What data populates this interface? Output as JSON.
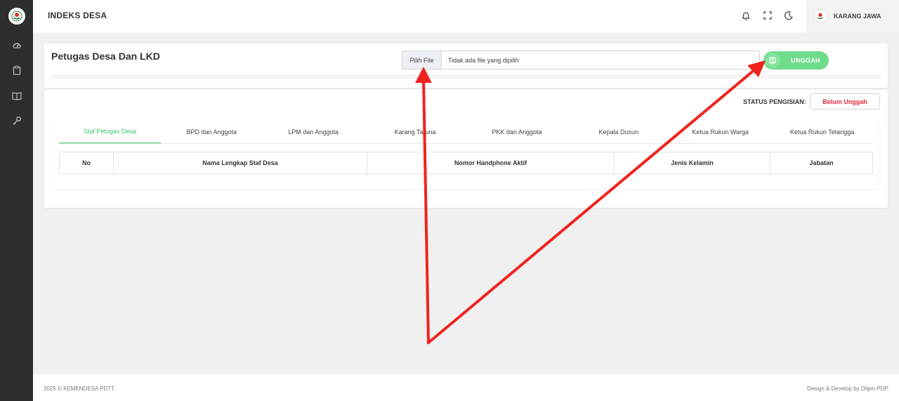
{
  "header": {
    "app_title": "INDEKS DESA",
    "user_name": "KARANG JAWA"
  },
  "sidebar": {
    "items": [
      {
        "icon": "dashboard-icon"
      },
      {
        "icon": "clipboard-icon"
      },
      {
        "icon": "book-icon"
      },
      {
        "icon": "key-icon"
      }
    ]
  },
  "main": {
    "page_title": "Petugas Desa Dan LKD",
    "file_input": {
      "button_label": "Pilih File",
      "value": "Tidak ada file yang dipilih"
    },
    "upload_button_label": "UNGGAH",
    "status_label": "STATUS PENGISIAN:",
    "status_value": "Belum Unggah",
    "tabs": [
      "Staf Petugas Desa",
      "BPD dan Anggota",
      "LPM dan Anggota",
      "Karang Taruna",
      "PKK dan Anggota",
      "Kepala Dusun",
      "Ketua Rukun Warga",
      "Ketua Rukun Tetangga"
    ],
    "active_tab": "Staf Petugas Desa",
    "table_headers": [
      "No",
      "Nama Lengkap Staf Desa",
      "Nomor Handphone Aktif",
      "Jenis Kelamin",
      "Jabatan"
    ]
  },
  "footer": {
    "left": "2025 © KEMENDESA PDTT.",
    "right": "Design & Develop by Ditjen PDP"
  },
  "colors": {
    "accent_green": "#3ec76b",
    "button_green": "#6fdc8c",
    "status_red": "#e4283c",
    "sidebar_dark": "#2b2f2d",
    "annotation_arrow": "#f0231e"
  }
}
